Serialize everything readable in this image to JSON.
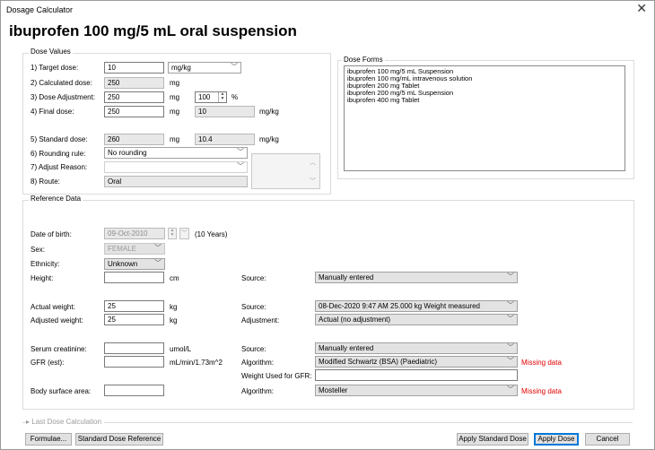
{
  "window": {
    "title": "Dosage Calculator",
    "close_glyph": "✕"
  },
  "drug_title": "ibuprofen 100 mg/5 mL oral suspension",
  "dose_values": {
    "group_label": "Dose Values",
    "target_dose_label": "1) Target dose:",
    "target_dose_value": "10",
    "target_dose_unit": "mg/kg",
    "calculated_dose_label": "2) Calculated dose:",
    "calculated_dose_value": "250",
    "calculated_dose_unit": "mg",
    "dose_adjustment_label": "3) Dose Adjustment:",
    "dose_adjustment_value": "250",
    "dose_adjustment_unit": "mg",
    "dose_adjustment_percent": "100",
    "percent_sign": "%",
    "final_dose_label": "4) Final dose:",
    "final_dose_value": "250",
    "final_dose_unit": "mg",
    "final_dose_per_kg": "10",
    "final_dose_per_kg_unit": "mg/kg",
    "standard_dose_label": "5) Standard dose:",
    "standard_dose_value": "260",
    "standard_dose_unit": "mg",
    "standard_dose_per_kg": "10.4",
    "standard_dose_per_kg_unit": "mg/kg",
    "rounding_rule_label": "6) Rounding rule:",
    "rounding_rule_value": "No rounding",
    "adjust_reason_label": "7) Adjust Reason:",
    "adjust_reason_value": "",
    "route_label": "8) Route:",
    "route_value": "Oral"
  },
  "dose_forms": {
    "group_label": "Dose Forms",
    "items": [
      "ibuprofen 100 mg/5 mL Suspension",
      "ibuprofen 100 mg/mL intravenous solution",
      "ibuprofen 200 mg Tablet",
      "ibuprofen 200 mg/5 mL Suspension",
      "ibuprofen 400 mg Tablet"
    ]
  },
  "reference": {
    "group_label": "Reference Data",
    "dob_label": "Date of birth:",
    "dob_value": "09-Oct-2010",
    "age_text": "(10 Years)",
    "sex_label": "Sex:",
    "sex_value": "FEMALE",
    "ethnicity_label": "Ethnicity:",
    "ethnicity_value": "Unknown",
    "height_label": "Height:",
    "height_value": "",
    "height_unit": "cm",
    "height_source_label": "Source:",
    "height_source_value": "Manually entered",
    "actual_weight_label": "Actual weight:",
    "actual_weight_value": "25",
    "actual_weight_unit": "kg",
    "weight_source_label": "Source:",
    "weight_source_value": "08-Dec-2020 9:47 AM   25.000 kg Weight measured",
    "adjusted_weight_label": "Adjusted weight:",
    "adjusted_weight_value": "25",
    "adjusted_weight_unit": "kg",
    "adjustment_label": "Adjustment:",
    "adjustment_value": "Actual (no adjustment)",
    "creat_label": "Serum creatinine:",
    "creat_value": "",
    "creat_unit": "umol/L",
    "creat_source_label": "Source:",
    "creat_source_value": "Manually entered",
    "gfr_label": "GFR (est):",
    "gfr_value": "",
    "gfr_unit": "mL/min/1.73m^2",
    "gfr_algorithm_label": "Algorithm:",
    "gfr_algorithm_value": "Modified Schwartz (BSA) (Paediatric)",
    "gfr_missing": "Missing data",
    "weight_gfr_label": "Weight Used for GFR:",
    "weight_gfr_value": "",
    "bsa_label": "Body surface area:",
    "bsa_value": "",
    "bsa_algorithm_label": "Algorithm:",
    "bsa_algorithm_value": "Mosteller",
    "bsa_missing": "Missing data"
  },
  "last_dose": {
    "label": "Last Dose Calculation"
  },
  "buttons": {
    "formulae": "Formulae...",
    "standard_ref": "Standard Dose Reference",
    "apply_standard": "Apply Standard Dose",
    "apply": "Apply Dose",
    "cancel": "Cancel"
  },
  "colors": {
    "missing": "#e00000",
    "accent": "#0078d7"
  }
}
